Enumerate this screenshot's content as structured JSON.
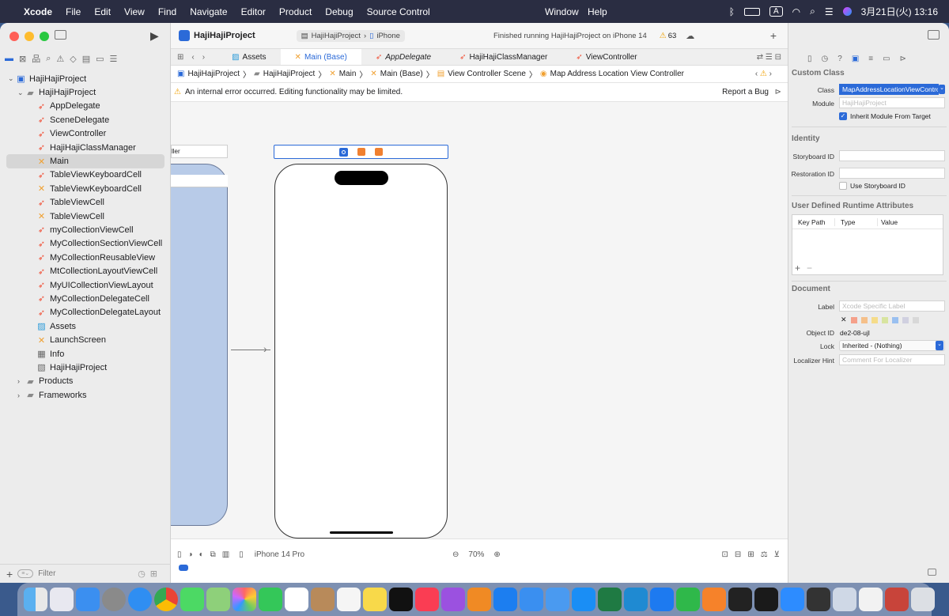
{
  "menubar": {
    "apple_glyph": "",
    "items": [
      "Xcode",
      "File",
      "Edit",
      "View",
      "Find",
      "Navigate",
      "Editor",
      "Product",
      "Debug",
      "Source Control",
      "Window",
      "Help"
    ],
    "input_mode": "A",
    "clock": "3月21日(火) 13:16"
  },
  "toolbar": {
    "project": "HajiHajiProject",
    "scheme": "HajiHajiProject",
    "device": "iPhone",
    "status": "Finished running HajiHajiProject on iPhone 14",
    "warnings": "63"
  },
  "tabs": [
    "Assets",
    "Main (Base)",
    "AppDelegate",
    "HajiHajiClassManager",
    "ViewController"
  ],
  "jump": [
    "HajiHajiProject",
    "HajiHajiProject",
    "Main",
    "Main (Base)",
    "View Controller Scene",
    "Map Address Location View Controller"
  ],
  "warning": {
    "text": "An internal error occurred. Editing functionality may be limited.",
    "report": "Report a Bug"
  },
  "navigator": {
    "root": "HajiHajiProject",
    "group": "HajiHajiProject",
    "files": [
      "AppDelegate",
      "SceneDelegate",
      "ViewController",
      "HajiHajiClassManager",
      "Main",
      "TableViewKeyboardCell",
      "TableViewKeyboardCell",
      "TableViewCell",
      "TableViewCell",
      "myCollectionViewCell",
      "MyCollectionSectionViewCell",
      "MyCollectionReusableView",
      "MtCollectionLayoutViewCell",
      "MyUICollectionViewLayout",
      "MyCollectionDelegateCell",
      "MyCollectionDelegateLayout",
      "Assets",
      "LaunchScreen",
      "Info",
      "HajiHajiProject"
    ],
    "folders": [
      "Products",
      "Frameworks"
    ],
    "filter_placeholder": "Filter"
  },
  "canvas": {
    "prev_scene_title": "ller",
    "device": "iPhone 14 Pro",
    "zoom": "70%"
  },
  "inspector": {
    "custom_class": "Custom Class",
    "class_label": "Class",
    "class_value": "MapAddressLocationViewController",
    "module_label": "Module",
    "module_value": "HajiHajiProject",
    "inherit": "Inherit Module From Target",
    "identity": "Identity",
    "storyboard_id": "Storyboard ID",
    "restoration_id": "Restoration ID",
    "use_storyboard": "Use Storyboard ID",
    "udra": "User Defined Runtime Attributes",
    "col_key": "Key Path",
    "col_type": "Type",
    "col_value": "Value",
    "document": "Document",
    "label_label": "Label",
    "label_placeholder": "Xcode Specific Label",
    "oid_label": "Object ID",
    "oid_value": "de2-08-ujl",
    "lock_label": "Lock",
    "lock_value": "Inherited - (Nothing)",
    "hint_label": "Localizer Hint",
    "hint_placeholder": "Comment For Localizer"
  },
  "colors": {
    "accent": "#2b6ad8",
    "swift": "#f05138",
    "ib": "#f0a030",
    "selection": "#d6d6d6"
  }
}
